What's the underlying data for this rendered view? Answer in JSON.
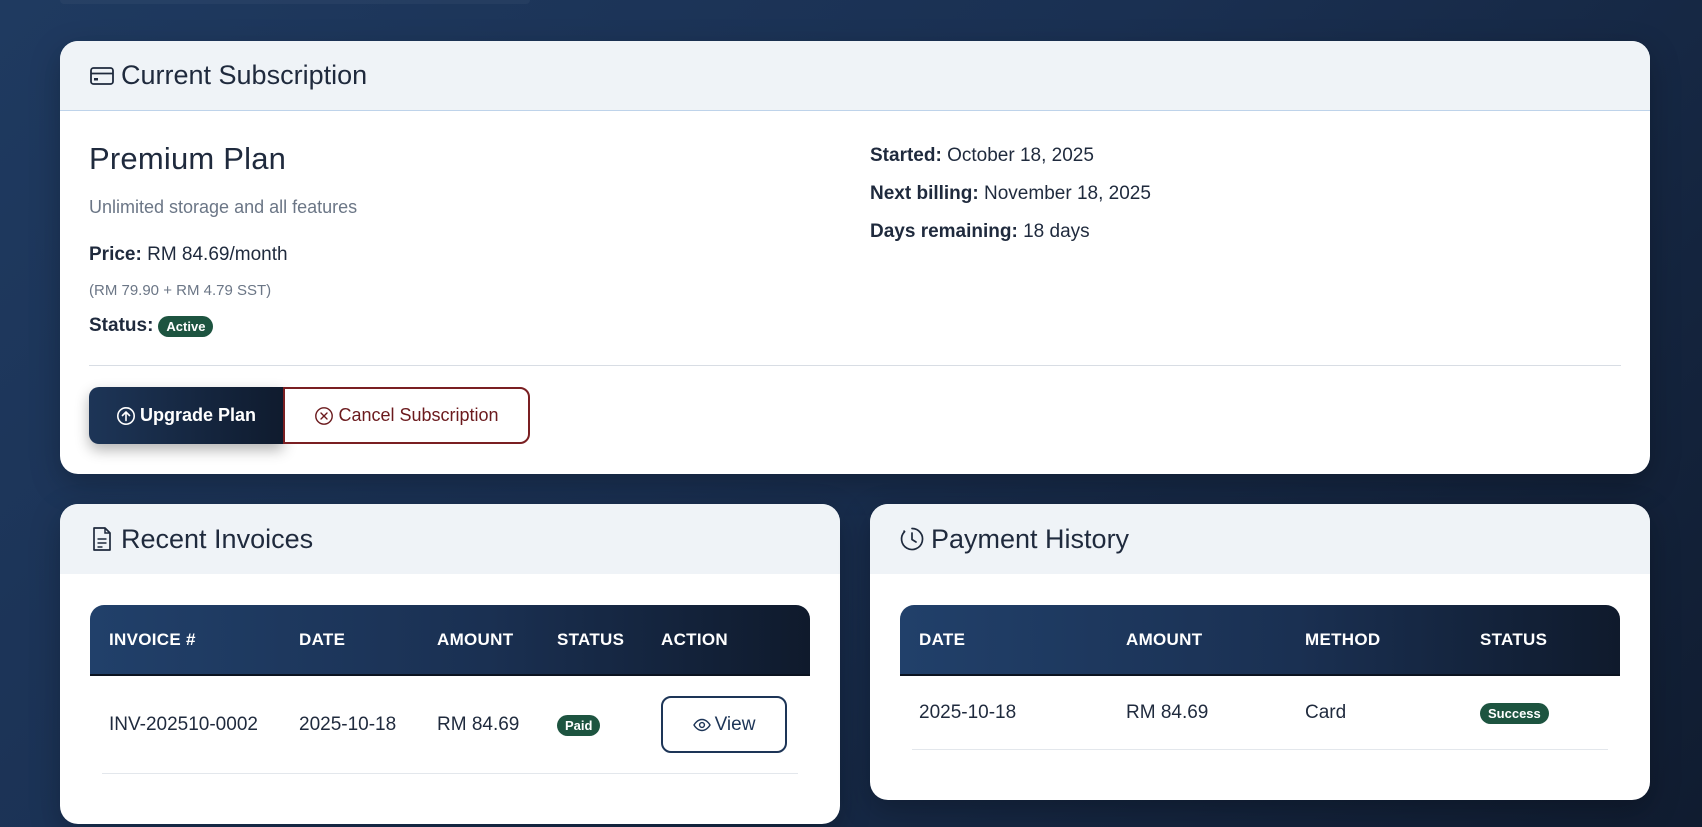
{
  "subscription": {
    "header_title": "Current Subscription",
    "plan_name": "Premium Plan",
    "plan_description": "Unlimited storage and all features",
    "price_label": "Price:",
    "price_value": "RM 84.69/month",
    "price_breakdown": "(RM 79.90 + RM 4.79 SST)",
    "status_label": "Status:",
    "status_value": "Active",
    "started_label": "Started:",
    "started_value": "October 18, 2025",
    "next_billing_label": "Next billing:",
    "next_billing_value": "November 18, 2025",
    "days_remaining_label": "Days remaining:",
    "days_remaining_value": "18 days",
    "upgrade_label": "Upgrade Plan",
    "cancel_label": "Cancel Subscription"
  },
  "invoices": {
    "header_title": "Recent Invoices",
    "columns": [
      "INVOICE #",
      "DATE",
      "AMOUNT",
      "STATUS",
      "ACTION"
    ],
    "rows": [
      {
        "invoice": "INV-202510-0002",
        "date": "2025-10-18",
        "amount": "RM 84.69",
        "status": "Paid",
        "action": "View"
      }
    ]
  },
  "payments": {
    "header_title": "Payment History",
    "columns": [
      "DATE",
      "AMOUNT",
      "METHOD",
      "STATUS"
    ],
    "rows": [
      {
        "date": "2025-10-18",
        "amount": "RM 84.69",
        "method": "Card",
        "status": "Success"
      }
    ]
  },
  "icons": {
    "subscription": "credit-card-icon",
    "upgrade": "arrow-up-circle-icon",
    "cancel": "x-circle-icon",
    "invoices": "document-icon",
    "payments": "clock-history-icon",
    "view": "eye-icon"
  },
  "colors": {
    "badge_green": "#1d5440",
    "cancel_red": "#7a1f22",
    "navy": "#1d3557"
  }
}
